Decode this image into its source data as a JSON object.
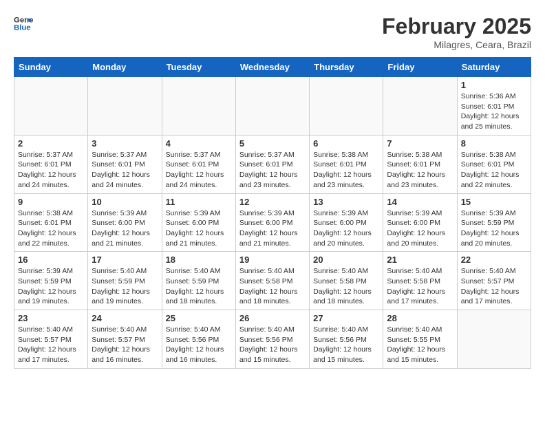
{
  "header": {
    "logo_line1": "General",
    "logo_line2": "Blue",
    "month_title": "February 2025",
    "subtitle": "Milagres, Ceara, Brazil"
  },
  "weekdays": [
    "Sunday",
    "Monday",
    "Tuesday",
    "Wednesday",
    "Thursday",
    "Friday",
    "Saturday"
  ],
  "weeks": [
    [
      {
        "day": "",
        "info": ""
      },
      {
        "day": "",
        "info": ""
      },
      {
        "day": "",
        "info": ""
      },
      {
        "day": "",
        "info": ""
      },
      {
        "day": "",
        "info": ""
      },
      {
        "day": "",
        "info": ""
      },
      {
        "day": "1",
        "info": "Sunrise: 5:36 AM\nSunset: 6:01 PM\nDaylight: 12 hours and 25 minutes."
      }
    ],
    [
      {
        "day": "2",
        "info": "Sunrise: 5:37 AM\nSunset: 6:01 PM\nDaylight: 12 hours and 24 minutes."
      },
      {
        "day": "3",
        "info": "Sunrise: 5:37 AM\nSunset: 6:01 PM\nDaylight: 12 hours and 24 minutes."
      },
      {
        "day": "4",
        "info": "Sunrise: 5:37 AM\nSunset: 6:01 PM\nDaylight: 12 hours and 24 minutes."
      },
      {
        "day": "5",
        "info": "Sunrise: 5:37 AM\nSunset: 6:01 PM\nDaylight: 12 hours and 23 minutes."
      },
      {
        "day": "6",
        "info": "Sunrise: 5:38 AM\nSunset: 6:01 PM\nDaylight: 12 hours and 23 minutes."
      },
      {
        "day": "7",
        "info": "Sunrise: 5:38 AM\nSunset: 6:01 PM\nDaylight: 12 hours and 23 minutes."
      },
      {
        "day": "8",
        "info": "Sunrise: 5:38 AM\nSunset: 6:01 PM\nDaylight: 12 hours and 22 minutes."
      }
    ],
    [
      {
        "day": "9",
        "info": "Sunrise: 5:38 AM\nSunset: 6:01 PM\nDaylight: 12 hours and 22 minutes."
      },
      {
        "day": "10",
        "info": "Sunrise: 5:39 AM\nSunset: 6:00 PM\nDaylight: 12 hours and 21 minutes."
      },
      {
        "day": "11",
        "info": "Sunrise: 5:39 AM\nSunset: 6:00 PM\nDaylight: 12 hours and 21 minutes."
      },
      {
        "day": "12",
        "info": "Sunrise: 5:39 AM\nSunset: 6:00 PM\nDaylight: 12 hours and 21 minutes."
      },
      {
        "day": "13",
        "info": "Sunrise: 5:39 AM\nSunset: 6:00 PM\nDaylight: 12 hours and 20 minutes."
      },
      {
        "day": "14",
        "info": "Sunrise: 5:39 AM\nSunset: 6:00 PM\nDaylight: 12 hours and 20 minutes."
      },
      {
        "day": "15",
        "info": "Sunrise: 5:39 AM\nSunset: 5:59 PM\nDaylight: 12 hours and 20 minutes."
      }
    ],
    [
      {
        "day": "16",
        "info": "Sunrise: 5:39 AM\nSunset: 5:59 PM\nDaylight: 12 hours and 19 minutes."
      },
      {
        "day": "17",
        "info": "Sunrise: 5:40 AM\nSunset: 5:59 PM\nDaylight: 12 hours and 19 minutes."
      },
      {
        "day": "18",
        "info": "Sunrise: 5:40 AM\nSunset: 5:59 PM\nDaylight: 12 hours and 18 minutes."
      },
      {
        "day": "19",
        "info": "Sunrise: 5:40 AM\nSunset: 5:58 PM\nDaylight: 12 hours and 18 minutes."
      },
      {
        "day": "20",
        "info": "Sunrise: 5:40 AM\nSunset: 5:58 PM\nDaylight: 12 hours and 18 minutes."
      },
      {
        "day": "21",
        "info": "Sunrise: 5:40 AM\nSunset: 5:58 PM\nDaylight: 12 hours and 17 minutes."
      },
      {
        "day": "22",
        "info": "Sunrise: 5:40 AM\nSunset: 5:57 PM\nDaylight: 12 hours and 17 minutes."
      }
    ],
    [
      {
        "day": "23",
        "info": "Sunrise: 5:40 AM\nSunset: 5:57 PM\nDaylight: 12 hours and 17 minutes."
      },
      {
        "day": "24",
        "info": "Sunrise: 5:40 AM\nSunset: 5:57 PM\nDaylight: 12 hours and 16 minutes."
      },
      {
        "day": "25",
        "info": "Sunrise: 5:40 AM\nSunset: 5:56 PM\nDaylight: 12 hours and 16 minutes."
      },
      {
        "day": "26",
        "info": "Sunrise: 5:40 AM\nSunset: 5:56 PM\nDaylight: 12 hours and 15 minutes."
      },
      {
        "day": "27",
        "info": "Sunrise: 5:40 AM\nSunset: 5:56 PM\nDaylight: 12 hours and 15 minutes."
      },
      {
        "day": "28",
        "info": "Sunrise: 5:40 AM\nSunset: 5:55 PM\nDaylight: 12 hours and 15 minutes."
      },
      {
        "day": "",
        "info": ""
      }
    ]
  ]
}
